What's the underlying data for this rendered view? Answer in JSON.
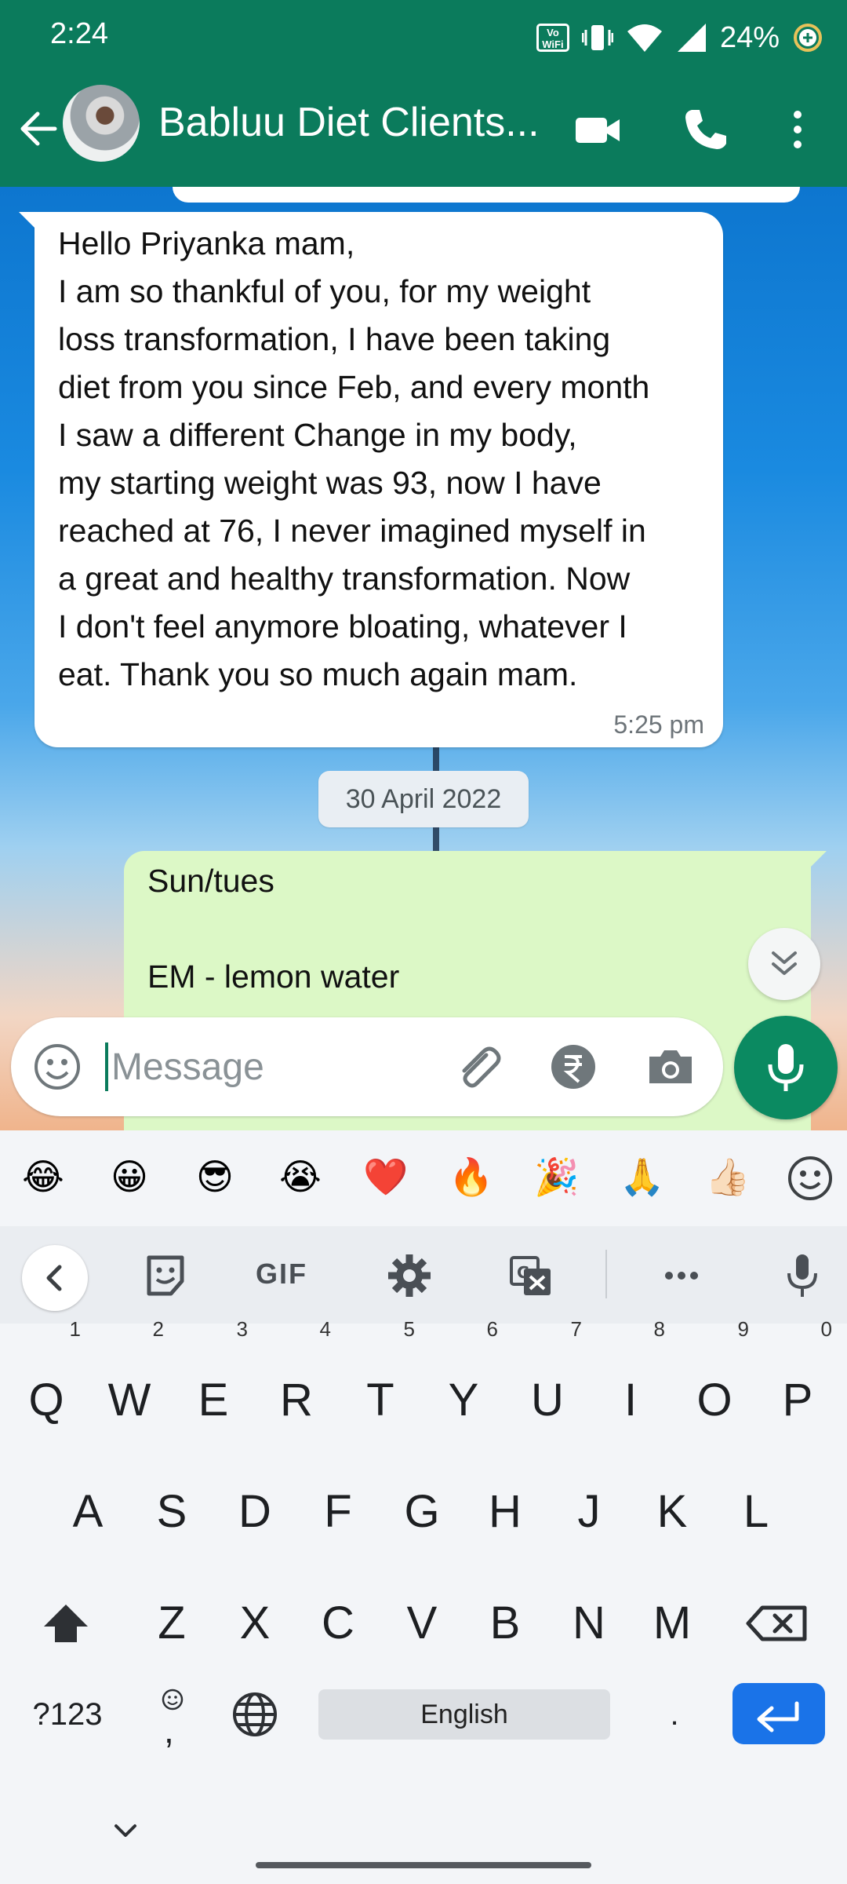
{
  "status_bar": {
    "time": "2:24",
    "vowifi": "Vo\nWiFi",
    "battery": "24%"
  },
  "header": {
    "title": "Babluu Diet Clients..."
  },
  "messages": {
    "incoming_text": "Hello Priyanka mam,\nI am so thankful of you, for my weight\nloss transformation, I have been taking\ndiet from you since Feb, and every month\nI saw a different Change in my body,\nmy starting weight was 93, now I have\nreached at 76, I never imagined myself in\na great and healthy transformation. Now\nI don't feel anymore bloating, whatever I\neat. Thank you so much again mam.",
    "incoming_time": "5:25 pm",
    "date_chip": "30 April 2022",
    "outgoing_text": "Sun/tues\n\nEM - lemon water"
  },
  "composer": {
    "placeholder": "Message"
  },
  "keyboard": {
    "emojis": [
      "😂",
      "😀",
      "😎",
      "😭",
      "❤️",
      "🔥",
      "🎉",
      "🙏",
      "👍🏻"
    ],
    "gif": "GIF",
    "row1": [
      "Q",
      "W",
      "E",
      "R",
      "T",
      "Y",
      "U",
      "I",
      "O",
      "P"
    ],
    "row1_hints": [
      "1",
      "2",
      "3",
      "4",
      "5",
      "6",
      "7",
      "8",
      "9",
      "0"
    ],
    "row2": [
      "A",
      "S",
      "D",
      "F",
      "G",
      "H",
      "J",
      "K",
      "L"
    ],
    "row3": [
      "Z",
      "X",
      "C",
      "V",
      "B",
      "N",
      "M"
    ],
    "symbols": "?123",
    "comma": ",",
    "space": "English",
    "period": "."
  },
  "colors": {
    "header": "#0b7b5c",
    "outgoing_bubble": "#dcf8c6",
    "fab": "#0b8a61",
    "enter": "#1a73e8"
  }
}
